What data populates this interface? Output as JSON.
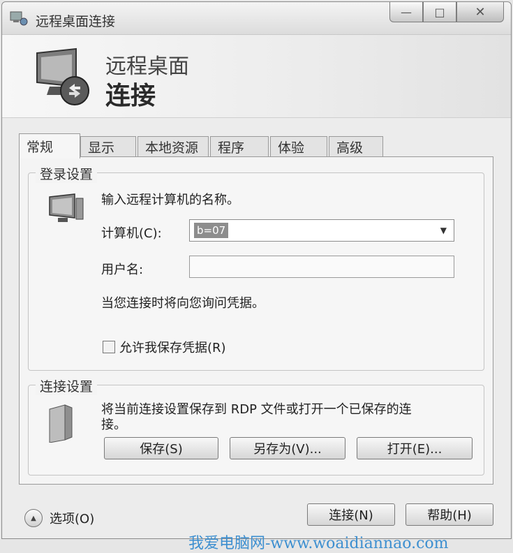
{
  "window": {
    "title": "远程桌面连接",
    "controls": {
      "minimize": "—",
      "maximize": "□",
      "close": "✕"
    }
  },
  "banner": {
    "line1": "远程桌面",
    "line2": "连接"
  },
  "tabs": [
    {
      "label": "常规",
      "active": true
    },
    {
      "label": "显示"
    },
    {
      "label": "本地资源"
    },
    {
      "label": "程序"
    },
    {
      "label": "体验"
    },
    {
      "label": "高级"
    }
  ],
  "login": {
    "group_title": "登录设置",
    "prompt": "输入远程计算机的名称。",
    "computer_label": "计算机(C):",
    "computer_value": "b=07",
    "username_label": "用户名:",
    "username_value": "",
    "credentials_note": "当您连接时将向您询问凭据。",
    "allow_save_label": "允许我保存凭据(R)",
    "allow_save_checked": false
  },
  "connection": {
    "group_title": "连接设置",
    "description_line1": "将当前连接设置保存到 RDP 文件或打开一个已保存的连",
    "description_line2": "接。",
    "save_label": "保存(S)",
    "save_as_label": "另存为(V)...",
    "open_label": "打开(E)..."
  },
  "footer": {
    "options_label": "选项(O)",
    "connect_label": "连接(N)",
    "help_label": "帮助(H)"
  },
  "watermark": "我爱电脑网-www.woaidiannao.com"
}
